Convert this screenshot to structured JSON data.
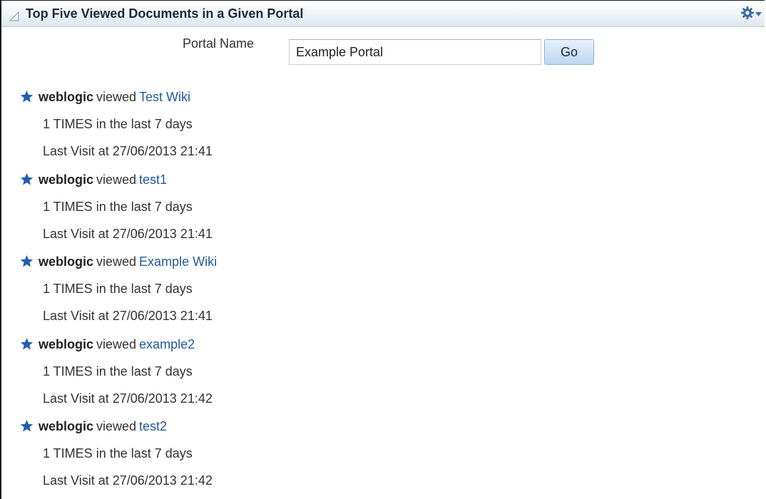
{
  "header": {
    "title": "Top Five Viewed Documents in a Given Portal",
    "collapse_icon": "collapse-triangle-icon",
    "menu_icon": "gear-icon"
  },
  "search": {
    "label": "Portal Name",
    "value": "Example Portal",
    "button_label": "Go"
  },
  "colors": {
    "link": "#21599a",
    "star": "#1f5eb4",
    "header_bg": "#e6edf2"
  },
  "activities": [
    {
      "user": "weblogic",
      "verb": "viewed",
      "document": "Test Wiki",
      "times": "1 TIMES",
      "period": "in the last 7 days",
      "last_visit": "Last Visit at 27/06/2013 21:41"
    },
    {
      "user": "weblogic",
      "verb": "viewed",
      "document": "test1",
      "times": "1 TIMES",
      "period": "in the last 7 days",
      "last_visit": "Last Visit at 27/06/2013 21:41"
    },
    {
      "user": "weblogic",
      "verb": "viewed",
      "document": "Example Wiki",
      "times": "1 TIMES",
      "period": "in the last 7 days",
      "last_visit": "Last Visit at 27/06/2013 21:41"
    },
    {
      "user": "weblogic",
      "verb": "viewed",
      "document": "example2",
      "times": "1 TIMES",
      "period": "in the last 7 days",
      "last_visit": "Last Visit at 27/06/2013 21:42"
    },
    {
      "user": "weblogic",
      "verb": "viewed",
      "document": "test2",
      "times": "1 TIMES",
      "period": "in the last 7 days",
      "last_visit": "Last Visit at 27/06/2013 21:42"
    }
  ]
}
